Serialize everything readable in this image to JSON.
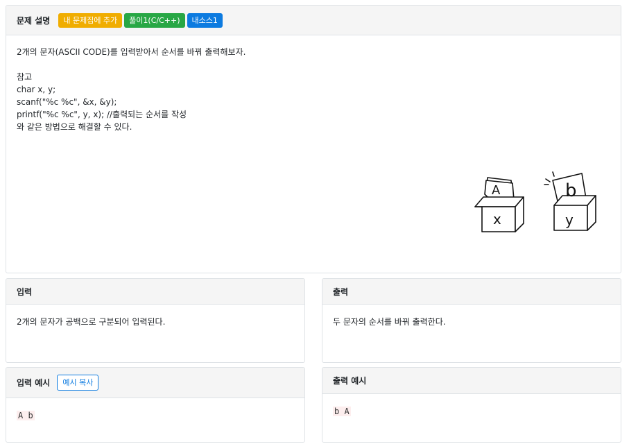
{
  "problem": {
    "title": "문제 설명",
    "badges": [
      "내 문제집에 추가",
      "풀이1(C/C++)",
      "내소스1"
    ],
    "description_lines": [
      "2개의 문자(ASCII CODE)를 입력받아서 순서를 바꿔 출력해보자.",
      "",
      "참고",
      "char x, y;",
      "scanf(\"%c %c\", &x, &y);",
      "printf(\"%c %c\", y, x); //출력되는 순서를 작성",
      "와 같은 방법으로 해결할 수 있다."
    ],
    "illustration": {
      "left_box_label": "x",
      "left_card_label": "A",
      "right_box_label": "y",
      "right_card_label": "b"
    }
  },
  "input": {
    "title": "입력",
    "text": "2개의 문자가 공백으로 구분되어 입력된다."
  },
  "output": {
    "title": "출력",
    "text": "두 문자의 순서를 바꿔 출력한다."
  },
  "sample_input": {
    "title": "입력 예시",
    "copy_label": "예시 복사",
    "value": "A b"
  },
  "sample_output": {
    "title": "출력 예시",
    "value": "b A"
  },
  "colors": {
    "header_bg": "#f5f5f5",
    "border": "#dee2e6",
    "badge_yellow": "#f0ad00",
    "badge_green": "#28a745",
    "badge_blue": "#0d7be0",
    "code_bg": "#fdeeee"
  }
}
